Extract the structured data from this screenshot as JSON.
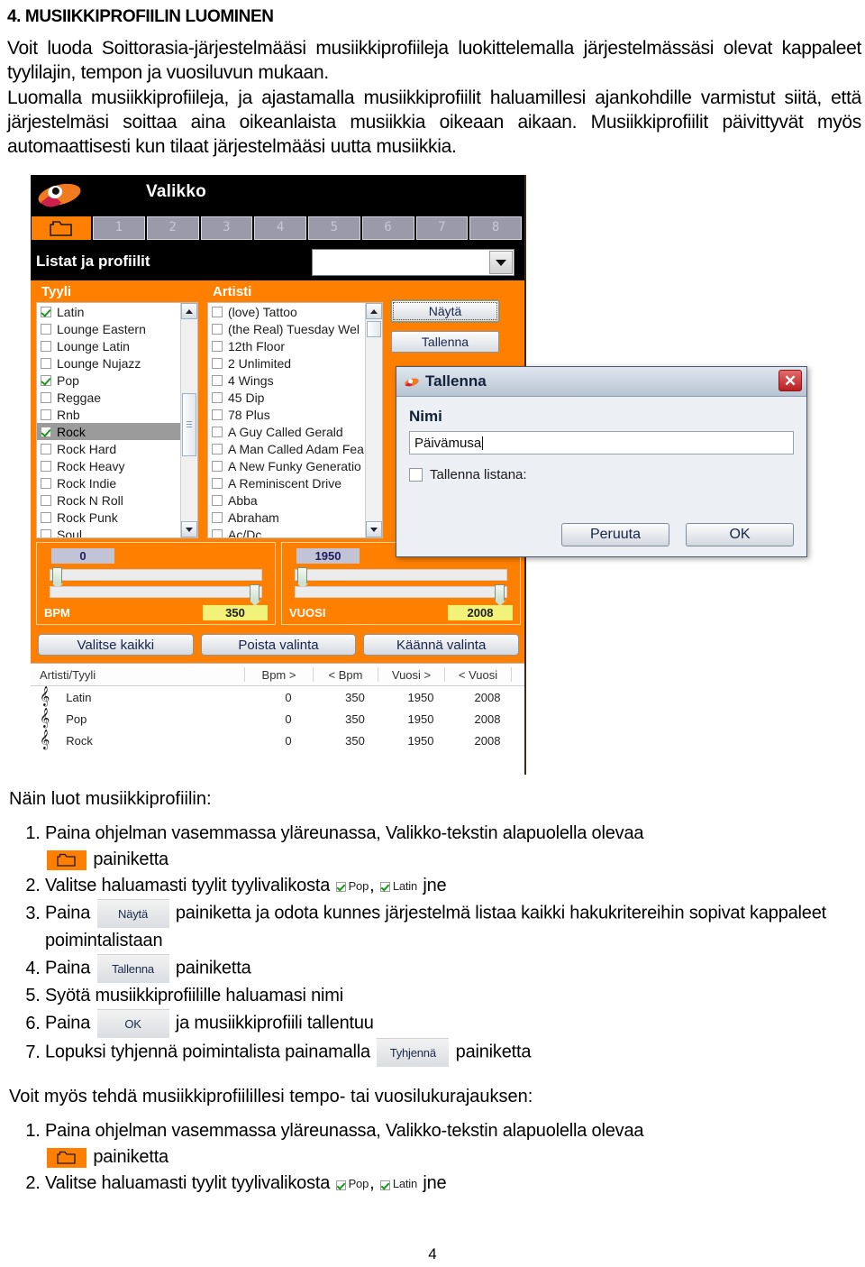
{
  "document": {
    "heading": "4. MUSIIKKIPROFIILIN LUOMINEN",
    "paragraphs": [
      "Voit luoda Soittorasia-järjestelmääsi musiikkiprofiileja luokittelemalla järjestelmässäsi olevat kappaleet tyylilajin, tempon ja vuosiluvun mukaan.",
      "Luomalla musiikkiprofiileja, ja ajastamalla musiikkiprofiilit haluamillesi ajankohdille varmistut siitä, että järjestelmäsi soittaa aina oikeanlaista musiikkia oikeaan aikaan. Musiikkiprofiilit päivittyvät myös automaattisesti kun tilaat järjestelmääsi uutta musiikkia."
    ],
    "page_number": "4"
  },
  "app": {
    "header": {
      "title": "Valikko",
      "logo_icon": "soittorasia-logo-icon"
    },
    "tabs": {
      "folder_icon": "folder-icon",
      "numbers": [
        "1",
        "2",
        "3",
        "4",
        "5",
        "6",
        "7",
        "8"
      ],
      "active_index": 0
    },
    "profiles": {
      "label": "Listat ja profiilit",
      "combo_value": "",
      "combo_icon": "chevron-down-icon"
    },
    "style_panel": {
      "header": "Tyyli",
      "items": [
        {
          "label": "Latin",
          "checked": true,
          "selected": false
        },
        {
          "label": "Lounge Eastern",
          "checked": false,
          "selected": false
        },
        {
          "label": "Lounge Latin",
          "checked": false,
          "selected": false
        },
        {
          "label": "Lounge Nujazz",
          "checked": false,
          "selected": false
        },
        {
          "label": "Pop",
          "checked": true,
          "selected": false
        },
        {
          "label": "Reggae",
          "checked": false,
          "selected": false
        },
        {
          "label": "Rnb",
          "checked": false,
          "selected": false
        },
        {
          "label": "Rock",
          "checked": true,
          "selected": true
        },
        {
          "label": "Rock Hard",
          "checked": false,
          "selected": false
        },
        {
          "label": "Rock Heavy",
          "checked": false,
          "selected": false
        },
        {
          "label": "Rock Indie",
          "checked": false,
          "selected": false
        },
        {
          "label": "Rock N Roll",
          "checked": false,
          "selected": false
        },
        {
          "label": "Rock Punk",
          "checked": false,
          "selected": false
        },
        {
          "label": "Soul",
          "checked": false,
          "selected": false
        }
      ]
    },
    "artist_panel": {
      "header": "Artisti",
      "items": [
        {
          "label": "(love) Tattoo",
          "checked": false
        },
        {
          "label": "(the Real) Tuesday Wel",
          "checked": false
        },
        {
          "label": "12th Floor",
          "checked": false
        },
        {
          "label": "2 Unlimited",
          "checked": false
        },
        {
          "label": "4 Wings",
          "checked": false
        },
        {
          "label": "45 Dip",
          "checked": false
        },
        {
          "label": "78 Plus",
          "checked": false
        },
        {
          "label": "A Guy Called Gerald",
          "checked": false
        },
        {
          "label": "A Man Called Adam Fea",
          "checked": false
        },
        {
          "label": "A New Funky Generatio",
          "checked": false
        },
        {
          "label": "A Reminiscent Drive",
          "checked": false
        },
        {
          "label": "Abba",
          "checked": false
        },
        {
          "label": "Abraham",
          "checked": false
        },
        {
          "label": "Ac/Dc",
          "checked": false
        }
      ]
    },
    "side_buttons": [
      {
        "label": "Näytä",
        "focused": true
      },
      {
        "label": "Tallenna",
        "focused": false
      }
    ],
    "sliders": [
      {
        "name": "BPM",
        "min": "0",
        "max": "350"
      },
      {
        "name": "VUOSI",
        "min": "1950",
        "max": "2008"
      }
    ],
    "action_buttons": [
      "Valitse kaikki",
      "Poista valinta",
      "Käännä valinta"
    ],
    "table": {
      "headers": [
        "Artisti/Tyyli",
        "Bpm >",
        "< Bpm",
        "Vuosi >",
        "< Vuosi"
      ],
      "rows": [
        {
          "icon": "music-clef-icon",
          "name": "Latin",
          "bpm_min": "0",
          "bpm_max": "350",
          "year_min": "1950",
          "year_max": "2008"
        },
        {
          "icon": "music-clef-icon",
          "name": "Pop",
          "bpm_min": "0",
          "bpm_max": "350",
          "year_min": "1950",
          "year_max": "2008"
        },
        {
          "icon": "music-clef-icon",
          "name": "Rock",
          "bpm_min": "0",
          "bpm_max": "350",
          "year_min": "1950",
          "year_max": "2008"
        }
      ]
    },
    "dialog": {
      "title": "Tallenna",
      "title_icon": "soittorasia-logo-icon",
      "close_icon": "close-icon",
      "name_label": "Nimi",
      "name_value": "Päivämusa",
      "checkbox_label": "Tallenna listana:",
      "checkbox_checked": false,
      "cancel_label": "Peruuta",
      "ok_label": "OK"
    }
  },
  "instructions": {
    "lead": "Näin luot musiikkiprofiilin:",
    "steps": [
      {
        "pre": "Paina ohjelman vasemmassa yläreunassa, Valikko-tekstin alapuolella olevaa",
        "folder": true,
        "post": "painiketta"
      },
      {
        "pre": "Valitse haluamasti tyylit tyylivalikosta",
        "chips": [
          "Pop",
          "Latin"
        ],
        "post": "jne"
      },
      {
        "pre": "Paina",
        "button": "Näytä",
        "post": "painiketta ja odota kunnes järjestelmä listaa kaikki hakukritereihin sopivat kappaleet poimintalistaan"
      },
      {
        "pre": "Paina",
        "button": "Tallenna",
        "post": "painiketta"
      },
      {
        "pre": "Syötä musiikkiprofiilille haluamasi nimi"
      },
      {
        "pre": "Paina",
        "button": "OK",
        "post": "ja musiikkiprofiili tallentuu"
      },
      {
        "pre": "Lopuksi tyhjennä poimintalista painamalla",
        "button": "Tyhjennä",
        "post": "painiketta"
      }
    ],
    "lead2": "Voit myös tehdä musiikkiprofiilillesi tempo- tai vuosilukurajauksen:",
    "steps2": [
      {
        "pre": "Paina ohjelman vasemmassa yläreunassa, Valikko-tekstin alapuolella olevaa",
        "folder": true,
        "post": "painiketta"
      },
      {
        "pre": "Valitse haluamasti tyylit tyylivalikosta",
        "chips": [
          "Pop",
          "Latin"
        ],
        "post": "jne"
      }
    ]
  },
  "colors": {
    "orange": "#FF8000",
    "black": "#000000",
    "yellow_value": "#F2F27A",
    "selection_gray": "#9B9B9B",
    "check_green": "#199919"
  }
}
